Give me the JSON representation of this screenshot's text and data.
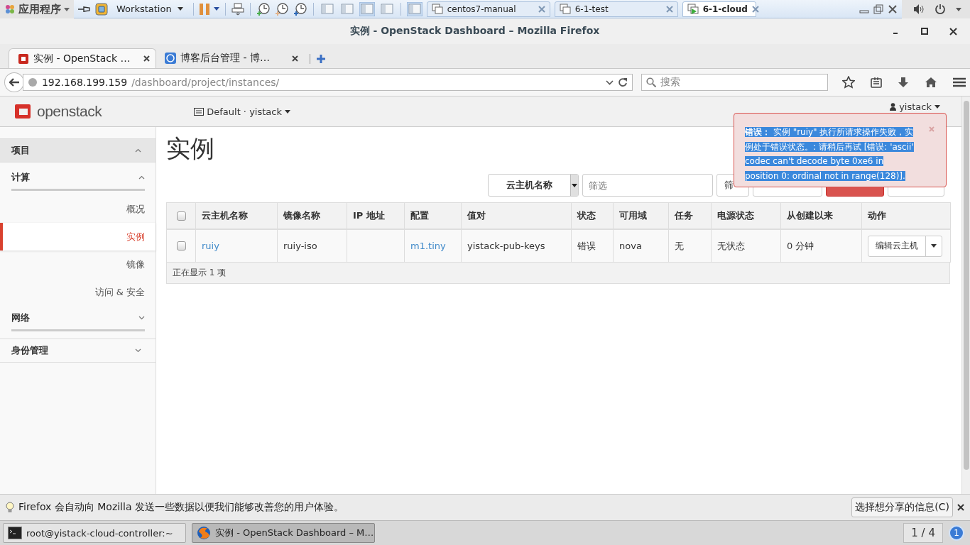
{
  "vm_bar": {
    "apps_menu": "应用程序",
    "workstation_menu": "Workstation",
    "tabs": [
      {
        "label": "centos7-manual",
        "selected": false
      },
      {
        "label": "6-1-test",
        "selected": false
      },
      {
        "label": "6-1-cloud",
        "selected": true
      }
    ]
  },
  "window": {
    "title": "实例 - OpenStack Dashboard – Mozilla Firefox"
  },
  "browser_tabs": [
    {
      "title": "实例 - OpenStack …",
      "selected": true
    },
    {
      "title": "博客后台管理 - 博…",
      "selected": false
    }
  ],
  "address_bar": {
    "host": "192.168.199.159",
    "path": "/dashboard/project/instances/"
  },
  "search": {
    "placeholder": "搜索"
  },
  "header": {
    "logo": "openstack",
    "project": "Default · yistack",
    "user": "yistack"
  },
  "sidebar": [
    {
      "label": "项目",
      "expanded": true,
      "children": [
        {
          "label": "计算",
          "expanded": true,
          "children": [
            {
              "label": "概况",
              "selected": false
            },
            {
              "label": "实例",
              "selected": true
            },
            {
              "label": "镜像",
              "selected": false
            },
            {
              "label": "访问 & 安全",
              "selected": false
            }
          ]
        },
        {
          "label": "网络",
          "expanded": false
        }
      ]
    },
    {
      "label": "身份管理",
      "expanded": false
    }
  ],
  "page_title": "实例",
  "toolbar": {
    "filter_field": "云主机名称",
    "filter": {
      "placeholder": "筛选"
    },
    "filter_button": "筛"
  },
  "table": {
    "header_checkbox": {
      "checked": false
    },
    "columns": [
      "云主机名称",
      "镜像名称",
      "IP 地址",
      "配置",
      "值对",
      "状态",
      "可用域",
      "任务",
      "电源状态",
      "从创建以来",
      "动作"
    ],
    "rows": [
      {
        "checked": false,
        "cells": [
          {
            "kind": "link",
            "text": "ruiy"
          },
          {
            "kind": "text",
            "text": "ruiy-iso"
          },
          {
            "kind": "text"
          },
          {
            "kind": "link",
            "text": "m1.tiny"
          },
          {
            "kind": "text",
            "text": "yistack-pub-keys"
          },
          {
            "kind": "text",
            "text": "错误"
          },
          {
            "kind": "text",
            "text": "nova"
          },
          {
            "kind": "text",
            "text": "无"
          },
          {
            "kind": "text",
            "text": "无状态"
          },
          {
            "kind": "text",
            "text": "0 分钟"
          },
          {
            "kind": "split_button",
            "text": "编辑云主机"
          }
        ]
      }
    ],
    "footer": "正在显示 1 项"
  },
  "alert": {
    "message": "**错误：** 实例 \"ruiy\" 执行所请求操作失败，实例处于错误状态。: 请稍后再试 [错误: 'ascii' codec can't decode byte 0xe6 in position 0: ordinal not in range(128)]."
  },
  "notification": {
    "message": "Firefox 会自动向 Mozilla 发送一些数据以便我们能够改善您的用户体验。",
    "button": "选择想分享的信息(C)"
  },
  "taskbar": {
    "windows": [
      {
        "kind": "terminal",
        "label": "root@yistack-cloud-controller:~",
        "selected": false
      },
      {
        "kind": "browser",
        "label": "实例 - OpenStack Dashboard – M…",
        "selected": true
      }
    ],
    "workspace": "1 / 4",
    "notifications": "1"
  }
}
